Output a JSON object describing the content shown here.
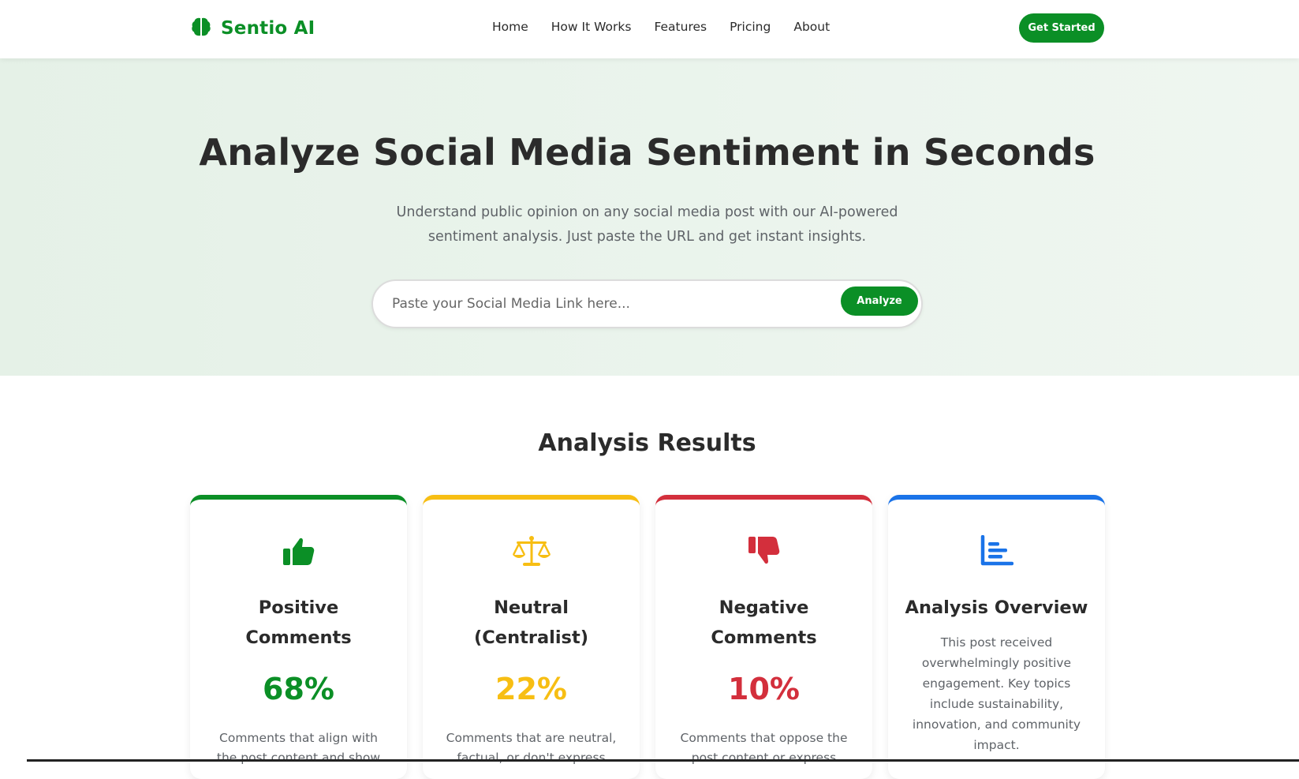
{
  "brand": {
    "name": "Sentio AI",
    "icon": "brain-icon",
    "color": "#0b8f26"
  },
  "nav": {
    "links": [
      "Home",
      "How It Works",
      "Features",
      "Pricing",
      "About"
    ],
    "cta": "Get Started"
  },
  "hero": {
    "title": "Analyze Social Media Sentiment in Seconds",
    "subtitle": "Understand public opinion on any social media post with our AI-powered sentiment analysis. Just paste the URL and get instant insights.",
    "search": {
      "placeholder": "Paste your Social Media Link here...",
      "value": "",
      "button": "Analyze"
    }
  },
  "results": {
    "title": "Analysis Results",
    "cards": [
      {
        "icon": "thumbs-up-icon",
        "color": "#0b8f26",
        "title": "Positive Comments",
        "value": "68%",
        "description": "Comments that align with the post content and show"
      },
      {
        "icon": "balance-scale-icon",
        "color": "#f7be13",
        "title": "Neutral (Centralist)",
        "value": "22%",
        "description": "Comments that are neutral, factual, or don't express"
      },
      {
        "icon": "thumbs-down-icon",
        "color": "#d32f3c",
        "title": "Negative Comments",
        "value": "10%",
        "description": "Comments that oppose the post content or express"
      },
      {
        "icon": "bar-chart-icon",
        "color": "#1a73e8",
        "title": "Analysis Overview",
        "text": "This post received overwhelmingly positive engagement. Key topics include sustainability, innovation, and community impact."
      }
    ]
  }
}
